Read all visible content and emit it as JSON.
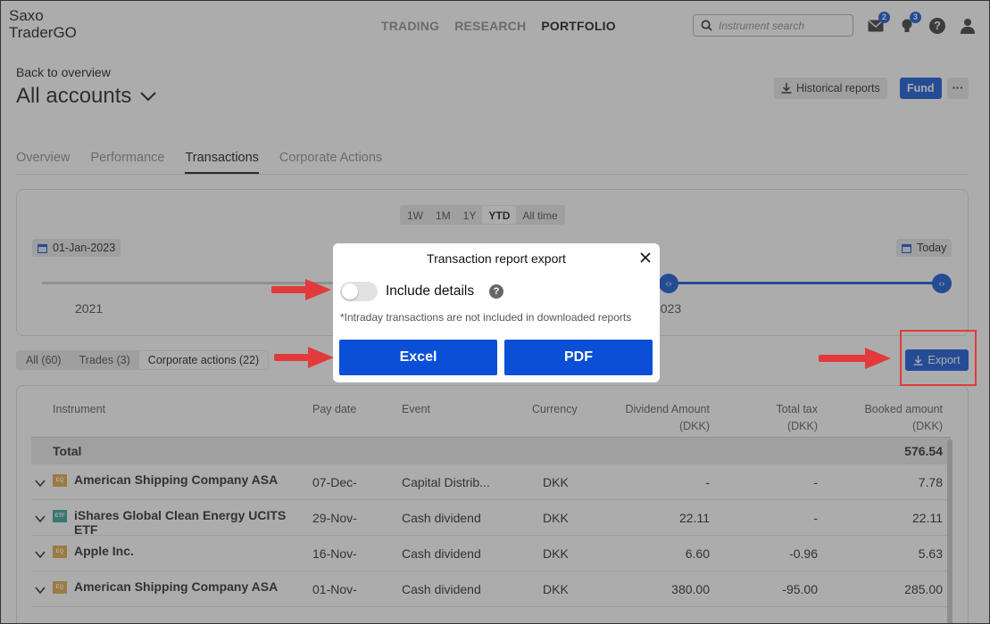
{
  "app": {
    "logo_line1": "Saxo",
    "logo_line2": "TraderGO"
  },
  "nav": {
    "items": [
      "TRADING",
      "RESEARCH",
      "PORTFOLIO"
    ],
    "active": "PORTFOLIO"
  },
  "search": {
    "placeholder": "Instrument search"
  },
  "notifications": {
    "messages_count": "2",
    "alerts_count": "3"
  },
  "header": {
    "back_label": "Back to overview",
    "title": "All accounts",
    "historical_reports_label": "Historical reports",
    "fund_label": "Fund",
    "more_label": "···"
  },
  "tabs": [
    "Overview",
    "Performance",
    "Transactions",
    "Corporate Actions"
  ],
  "active_tab": "Transactions",
  "period": {
    "ranges": [
      "1W",
      "1M",
      "1Y",
      "YTD",
      "All time"
    ],
    "active_range": "YTD",
    "start_date": "01-Jan-2023",
    "end_date": "Today",
    "year_left": "2021",
    "year_right": "2023"
  },
  "filters": {
    "items": [
      "All (60)",
      "Trades (3)",
      "Corporate actions (22)"
    ],
    "active": "Corporate actions (22)",
    "export_label": "Export"
  },
  "table": {
    "headers": {
      "instrument": "Instrument",
      "pay_date": "Pay date",
      "event": "Event",
      "currency": "Currency",
      "dividend_amount": "Dividend Amount",
      "dividend_amount_unit": "(DKK)",
      "total_tax": "Total tax",
      "total_tax_unit": "(DKK)",
      "booked_amount": "Booked amount",
      "booked_amount_unit": "(DKK)"
    },
    "total_label": "Total",
    "total_value": "576.54",
    "rows": [
      {
        "type": "EQ",
        "name": "American Shipping Company ASA",
        "name2": "",
        "pay_date": "07-Dec-",
        "event": "Capital Distrib...",
        "currency": "DKK",
        "dividend": "-",
        "tax": "-",
        "booked": "7.78"
      },
      {
        "type": "ETF",
        "name": "iShares Global Clean Energy UCITS",
        "name2": "ETF",
        "pay_date": "29-Nov-",
        "event": "Cash dividend",
        "currency": "DKK",
        "dividend": "22.11",
        "tax": "-",
        "booked": "22.11"
      },
      {
        "type": "EQ",
        "name": "Apple Inc.",
        "name2": "",
        "pay_date": "16-Nov-",
        "event": "Cash dividend",
        "currency": "DKK",
        "dividend": "6.60",
        "tax": "-0.96",
        "booked": "5.63"
      },
      {
        "type": "EQ",
        "name": "American Shipping Company ASA",
        "name2": "",
        "pay_date": "01-Nov-",
        "event": "Cash dividend",
        "currency": "DKK",
        "dividend": "380.00",
        "tax": "-95.00",
        "booked": "285.00"
      }
    ]
  },
  "modal": {
    "title": "Transaction report export",
    "include_details_label": "Include details",
    "include_details_on": false,
    "help_glyph": "?",
    "note": "*Intraday transactions are not included in downloaded reports",
    "excel_label": "Excel",
    "pdf_label": "PDF"
  },
  "colors": {
    "accent": "#0a4fd6",
    "annotation": "#e23a3a"
  }
}
